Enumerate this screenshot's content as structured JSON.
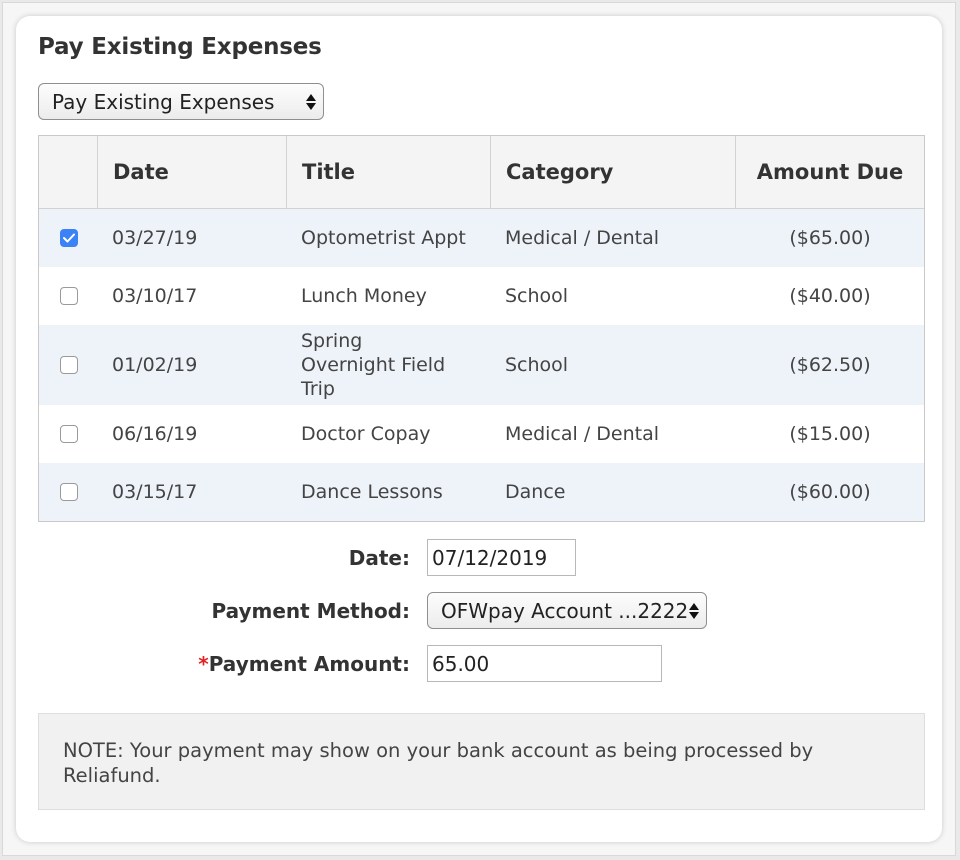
{
  "page": {
    "title": "Pay Existing Expenses",
    "type_select": {
      "selected": "Pay Existing Expenses"
    }
  },
  "table": {
    "columns": [
      "Date",
      "Title",
      "Category",
      "Amount Due"
    ],
    "rows": [
      {
        "checked": true,
        "date": "03/27/19",
        "title": "Optometrist Appt",
        "category": "Medical / Dental",
        "amount": "($65.00)"
      },
      {
        "checked": false,
        "date": "03/10/17",
        "title": "Lunch Money",
        "category": "School",
        "amount": "($40.00)"
      },
      {
        "checked": false,
        "date": "01/02/19",
        "title": "Spring Overnight Field Trip",
        "category": "School",
        "amount": "($62.50)"
      },
      {
        "checked": false,
        "date": "06/16/19",
        "title": "Doctor Copay",
        "category": "Medical / Dental",
        "amount": "($15.00)"
      },
      {
        "checked": false,
        "date": "03/15/17",
        "title": "Dance Lessons",
        "category": "Dance",
        "amount": "($60.00)"
      }
    ]
  },
  "form": {
    "date_label": "Date:",
    "date_value": "07/12/2019",
    "method_label": "Payment Method:",
    "method_value": "OFWpay Account ...2222",
    "amount_required_mark": "*",
    "amount_label": "Payment Amount:",
    "amount_value": "65.00"
  },
  "note": "NOTE: Your payment may show on your bank account as being processed by Reliafund.",
  "colors": {
    "checkbox_checked": "#3b82f6",
    "row_alt": "#eef3fa",
    "required": "#e02424"
  }
}
